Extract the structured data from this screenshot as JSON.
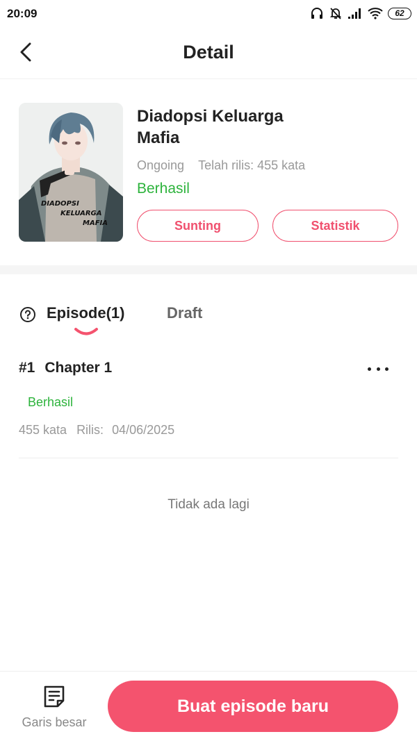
{
  "status_bar": {
    "time": "20:09",
    "battery": "62",
    "icons": [
      "headphones-icon",
      "bell-off-icon",
      "signal-icon",
      "wifi-icon",
      "battery-icon"
    ]
  },
  "header": {
    "title": "Detail",
    "back_icon": "chevron-left-icon"
  },
  "book": {
    "title": "Diadopsi Keluarga Mafia",
    "cover_text": [
      "DIADOPSI",
      "KELUARGA",
      "MAFIA"
    ],
    "progress": "Ongoing",
    "released": "Telah rilis: 455 kata",
    "status": "Berhasil",
    "edit_label": "Sunting",
    "stats_label": "Statistik"
  },
  "tabs": {
    "episode_label": "Episode(1)",
    "draft_label": "Draft",
    "active": "Episode(1)"
  },
  "episodes": [
    {
      "number": "#1",
      "title": "Chapter 1",
      "status": "Berhasil",
      "words": "455 kata",
      "release_label": "Rilis:",
      "release_date": "04/06/2025"
    }
  ],
  "list_end_text": "Tidak ada lagi",
  "bottom": {
    "outline_label": "Garis besar",
    "new_episode_label": "Buat episode baru"
  },
  "colors": {
    "accent": "#f4536e",
    "success": "#2db33c",
    "muted": "#999999"
  }
}
